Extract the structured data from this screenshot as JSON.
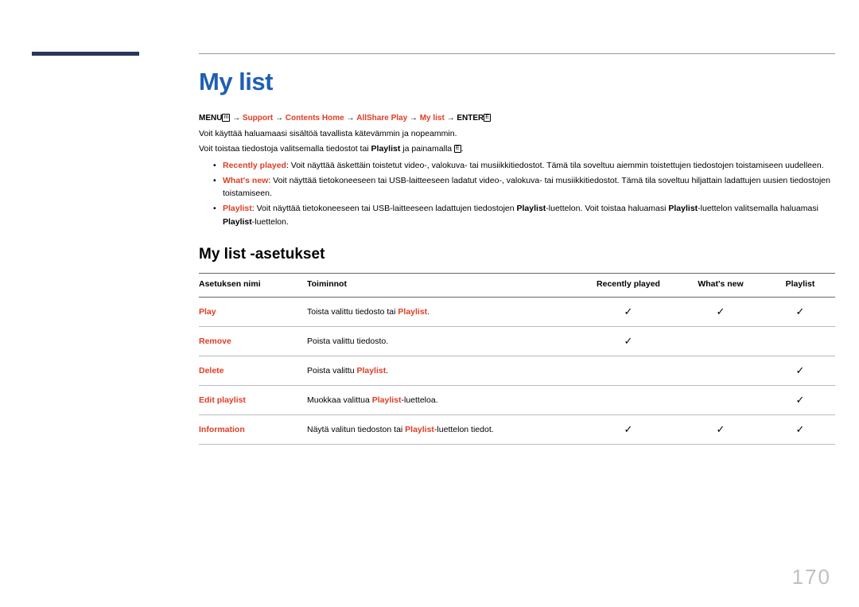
{
  "title": "My list",
  "breadcrumb": {
    "menu": "MENU",
    "arrow": " → ",
    "support": "Support",
    "contentsHome": "Contents Home",
    "allshare": "AllShare Play",
    "mylist": "My list",
    "enter": "ENTER"
  },
  "intro1": "Voit käyttää haluamaasi sisältöä tavallista kätevämmin ja nopeammin.",
  "intro2a": "Voit toistaa tiedostoja valitsemalla tiedostot tai ",
  "intro2b": "Playlist",
  "intro2c": " ja painamalla ",
  "bullets": [
    {
      "lead": "Recently played",
      "text": ": Voit näyttää äskettäin toistetut video-, valokuva- tai musiikkitiedostot. Tämä tila soveltuu aiemmin toistettujen tiedostojen toistamiseen uudelleen."
    },
    {
      "lead": "What's new",
      "text": ": Voit näyttää tietokoneeseen tai USB-laitteeseen ladatut video-, valokuva- tai musiikkitiedostot. Tämä tila soveltuu hiljattain ladattujen uusien tiedostojen toistamiseen."
    }
  ],
  "bullet3": {
    "lead": "Playlist",
    "t1": ": Voit näyttää tietokoneeseen tai USB-laitteeseen ladattujen tiedostojen ",
    "pl": "Playlist",
    "t2": "-luettelon. Voit toistaa haluamasi ",
    "t3": "-luettelon valitsemalla haluamasi ",
    "t4": "-luettelon."
  },
  "subheading": "My list -asetukset",
  "columns": {
    "name": "Asetuksen nimi",
    "func": "Toiminnot",
    "rp": "Recently played",
    "wn": "What's new",
    "pl": "Playlist"
  },
  "rows": [
    {
      "name": "Play",
      "func_a": "Toista valittu tiedosto tai ",
      "func_pl": "Playlist",
      "func_b": ".",
      "rp": true,
      "wn": true,
      "pl": true
    },
    {
      "name": "Remove",
      "func_a": "Poista valittu tiedosto.",
      "func_pl": "",
      "func_b": "",
      "rp": true,
      "wn": false,
      "pl": false
    },
    {
      "name": "Delete",
      "func_a": "Poista valittu ",
      "func_pl": "Playlist",
      "func_b": ".",
      "rp": false,
      "wn": false,
      "pl": true
    },
    {
      "name": "Edit playlist",
      "func_a": "Muokkaa valittua ",
      "func_pl": "Playlist",
      "func_b": "-luetteloa.",
      "rp": false,
      "wn": false,
      "pl": true
    },
    {
      "name": "Information",
      "func_a": "Näytä valitun tiedoston tai ",
      "func_pl": "Playlist",
      "func_b": "-luettelon tiedot.",
      "rp": true,
      "wn": true,
      "pl": true
    }
  ],
  "check": "✓",
  "pageNumber": "170"
}
